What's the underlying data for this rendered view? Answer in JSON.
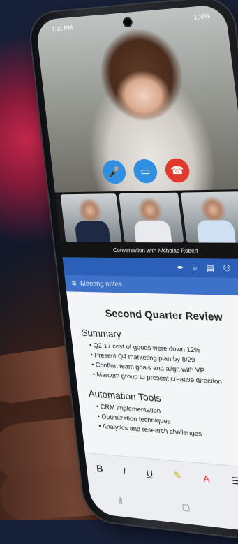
{
  "status": {
    "time": "1:11 PM",
    "battery": "100%"
  },
  "call": {
    "conversation_label": "Conversation with Nicholas Robert",
    "controls": {
      "mic_icon": "mic-icon",
      "video_icon": "video-icon",
      "hangup_icon": "hangup-icon"
    }
  },
  "app": {
    "header_title": "Meeting notes",
    "toolbar_icons": [
      "pen-icon",
      "search-icon",
      "notebook-icon",
      "person-icon",
      "undo-icon"
    ]
  },
  "doc": {
    "title": "Second Quarter Review",
    "sections": [
      {
        "heading": "Summary",
        "items": [
          "Q2-17 cost of goods were down 12%",
          "Present Q4 marketing plan by 8/29",
          "Confirm team goals and align with VP",
          "Marcom group to present creative direction"
        ]
      },
      {
        "heading": "Automation Tools",
        "items": [
          "CRM implementation",
          "Optimization techniques",
          "Analytics and research challenges"
        ]
      }
    ]
  },
  "format_bar": {
    "bold": "B",
    "italic": "I",
    "underline": "U",
    "highlight": "✎",
    "font_color": "A",
    "bullets": "☰",
    "numbering": "⋮"
  }
}
